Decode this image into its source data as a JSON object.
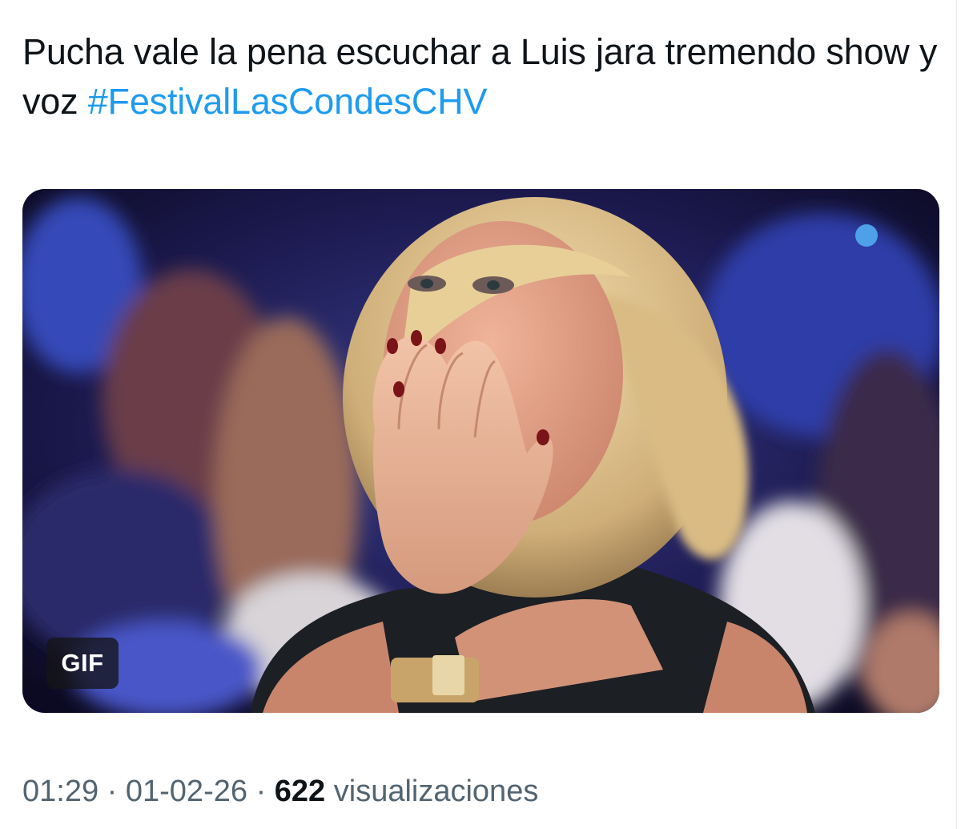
{
  "tweet": {
    "text": "Pucha vale la pena escuchar a Luis jara tremendo show y voz ",
    "hashtag": "#FestivalLasCondesCHV"
  },
  "media": {
    "badge": "GIF",
    "icon": "gif-thumbnail"
  },
  "meta": {
    "time": "01:29",
    "separator": "·",
    "date": "01-02-26",
    "views_count": "622",
    "views_label": "visualizaciones"
  },
  "colors": {
    "text": "#0f1419",
    "link": "#1d9bf0",
    "secondary": "#536471"
  }
}
